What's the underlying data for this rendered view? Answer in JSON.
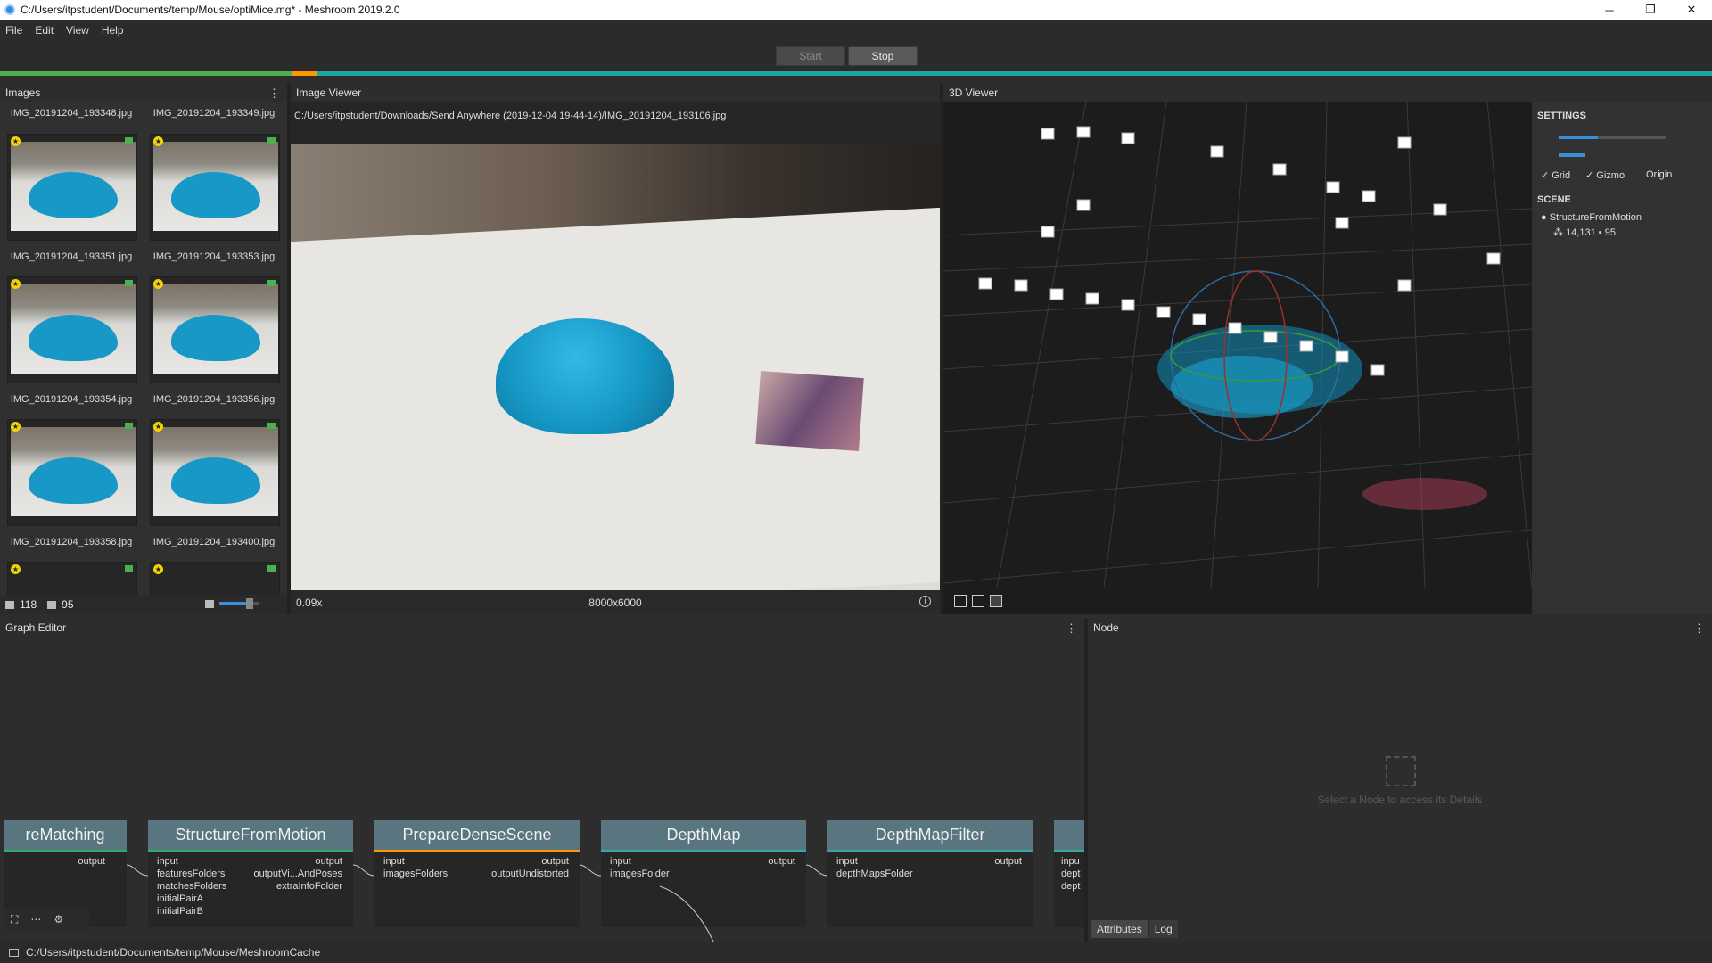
{
  "window": {
    "title": "C:/Users/itpstudent/Documents/temp/Mouse/optiMice.mg* - Meshroom 2019.2.0"
  },
  "menu": [
    "File",
    "Edit",
    "View",
    "Help"
  ],
  "toolbar": {
    "start_label": "Start",
    "stop_label": "Stop"
  },
  "images": {
    "title": "Images",
    "top_names": [
      "IMG_20191204_193348.jpg",
      "IMG_20191204_193349.jpg"
    ],
    "thumbs": [
      "IMG_20191204_193351.jpg",
      "IMG_20191204_193353.jpg",
      "IMG_20191204_193354.jpg",
      "IMG_20191204_193356.jpg",
      "IMG_20191204_193358.jpg",
      "IMG_20191204_193400.jpg"
    ],
    "image_count": "118",
    "camera_count": "95"
  },
  "viewer": {
    "title": "Image Viewer",
    "path": "C:/Users/itpstudent/Downloads/Send Anywhere (2019-12-04 19-44-14)/IMG_20191204_193106.jpg",
    "zoom": "0.09x",
    "resolution": "8000x6000"
  },
  "viewer3d": {
    "title": "3D Viewer",
    "settings_title": "SETTINGS",
    "grid_label": "Grid",
    "gizmo_label": "Gizmo",
    "origin_label": "Origin",
    "scene_title": "SCENE",
    "scene_item": "StructureFromMotion",
    "points": "14,131",
    "cameras": "95"
  },
  "graph": {
    "title": "Graph Editor",
    "nodes": [
      {
        "name": "reMatching",
        "ins": [],
        "outs": [
          "output"
        ]
      },
      {
        "name": "StructureFromMotion",
        "ins": [
          "input",
          "featuresFolders",
          "matchesFolders",
          "initialPairA",
          "initialPairB"
        ],
        "outs": [
          "output",
          "outputVi...AndPoses",
          "extraInfoFolder"
        ]
      },
      {
        "name": "PrepareDenseScene",
        "ins": [
          "input",
          "imagesFolders"
        ],
        "outs": [
          "output",
          "outputUndistorted"
        ]
      },
      {
        "name": "DepthMap",
        "ins": [
          "input",
          "imagesFolder"
        ],
        "outs": [
          "output"
        ]
      },
      {
        "name": "DepthMapFilter",
        "ins": [
          "input",
          "depthMapsFolder"
        ],
        "outs": [
          "output"
        ]
      },
      {
        "name": "",
        "ins": [
          "inpu",
          "dept",
          "dept"
        ],
        "outs": []
      }
    ]
  },
  "node_panel": {
    "title": "Node",
    "empty": "Select a Node to access its Details",
    "tabs": [
      "Attributes",
      "Log"
    ]
  },
  "status": {
    "path": "C:/Users/itpstudent/Documents/temp/Mouse/MeshroomCache"
  }
}
